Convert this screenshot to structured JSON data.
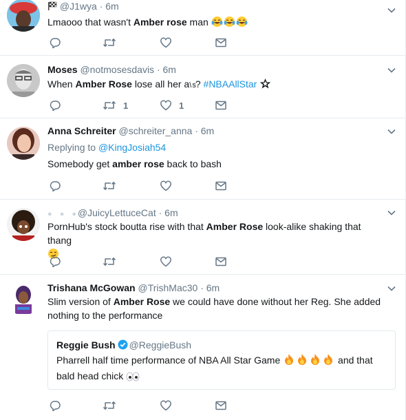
{
  "tweets": [
    {
      "handle": "@J1wya",
      "time": "6m",
      "text_a": "Lmaooo that wasn't ",
      "text_bold": "Amber rose",
      "text_b": " man ",
      "emoji": "laughing-tears",
      "reply_count": "",
      "retweet_count": "",
      "like_count": ""
    },
    {
      "name": "Moses",
      "handle": "@notmosesdavis",
      "time": "6m",
      "text_a": "When ",
      "text_bold": "Amber Rose",
      "text_b": " lose all her a",
      "text_obscured": "\\ s",
      "text_c": "? ",
      "hashtag": "#NBAAllStar",
      "retweet_count": "1",
      "like_count": "1"
    },
    {
      "name": "Anna Schreiter",
      "handle": "@schreiter_anna",
      "time": "6m",
      "replying_prefix": "Replying to ",
      "replying_to": "@KingJosiah54",
      "text_a": "Somebody get ",
      "text_bold": "amber rose",
      "text_b": " back to bash"
    },
    {
      "handle": "@JuicyLettuceCat",
      "time": "6m",
      "text_a": "PornHub's stock boutta rise with that ",
      "text_bold": "Amber Rose",
      "text_b": " look-alike shaking that thang"
    },
    {
      "name": "Trishana McGowan",
      "handle": "@TrishMac30",
      "time": "6m",
      "text_a": "Slim version of ",
      "text_bold": "Amber Rose",
      "text_b": " we could have done without her Reg. She added nothing to the performance",
      "quote": {
        "name": "Reggie Bush",
        "handle": "@ReggieBush",
        "text_a": "Pharrell half time performance of NBA All Star Game ",
        "text_b": " and that bald head chick "
      }
    }
  ],
  "colors": {
    "accent": "#1b95e0",
    "muted": "#657786",
    "divider": "#e6ecf0",
    "verified": "#1da1f2"
  }
}
